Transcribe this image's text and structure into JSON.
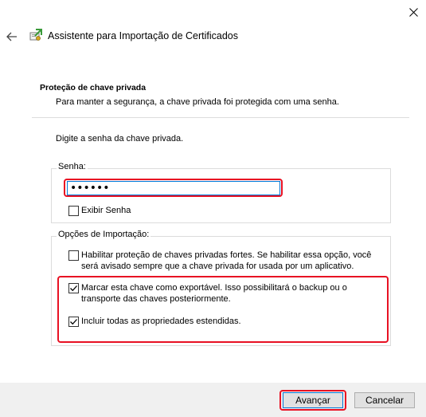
{
  "window": {
    "title": "Assistente para Importação de Certificados"
  },
  "section": {
    "heading": "Proteção de chave privada",
    "description": "Para manter a segurança, a chave privada foi protegida com uma senha."
  },
  "prompt": "Digite a senha da chave privada.",
  "password_group": {
    "legend": "Senha:",
    "value": "••••••",
    "show_password": {
      "label": "Exibir Senha",
      "checked": false
    }
  },
  "import_options": {
    "legend": "Opções de Importação:",
    "options": [
      {
        "label": "Habilitar proteção de chaves privadas fortes. Se habilitar essa opção, você será avisado sempre que a chave privada for usada por um aplicativo.",
        "checked": false
      },
      {
        "label": "Marcar esta chave como exportável. Isso possibilitará o backup ou o transporte das chaves posteriormente.",
        "checked": true
      },
      {
        "label": "Incluir todas as propriedades estendidas.",
        "checked": true
      }
    ]
  },
  "buttons": {
    "next": "Avançar",
    "cancel": "Cancelar"
  },
  "icons": {
    "close": "close-icon",
    "back": "back-arrow-icon",
    "wizard": "certificate-wizard-icon"
  },
  "colors": {
    "highlight": "#e81123",
    "accent": "#0078d7"
  }
}
